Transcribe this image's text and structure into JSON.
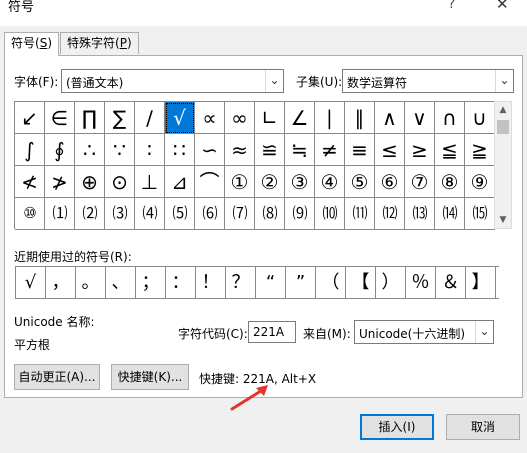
{
  "window": {
    "title": "符号",
    "help_glyph": "?",
    "close_glyph": "✕"
  },
  "tabs": [
    {
      "label": "符号(",
      "key": "S",
      "end": ")"
    },
    {
      "label": "特殊字符(",
      "key": "P",
      "end": ")"
    }
  ],
  "font": {
    "label": "字体(F):",
    "value": "(普通文本)"
  },
  "subset": {
    "label": "子集(U):",
    "value": "数学运算符"
  },
  "symbols": [
    "↙",
    "∈",
    "∏",
    "∑",
    "∕",
    "√",
    "∝",
    "∞",
    "∟",
    "∠",
    "∣",
    "∥",
    "∧",
    "∨",
    "∩",
    "∪",
    "∫",
    "∮",
    "∴",
    "∵",
    "∶",
    "∷",
    "∽",
    "≈",
    "≌",
    "≒",
    "≠",
    "≡",
    "≤",
    "≥",
    "≦",
    "≧",
    "≮",
    "≯",
    "⊕",
    "⊙",
    "⊥",
    "⊿",
    "⌒",
    "①",
    "②",
    "③",
    "④",
    "⑤",
    "⑥",
    "⑦",
    "⑧",
    "⑨",
    "⑩",
    "⑴",
    "⑵",
    "⑶",
    "⑷",
    "⑸",
    "⑹",
    "⑺",
    "⑻",
    "⑼",
    "⑽",
    "⑾",
    "⑿",
    "⒀",
    "⒁",
    "⒂"
  ],
  "selected_index": 5,
  "recent": {
    "label": "近期使用过的符号(R):",
    "items": [
      "√",
      "，",
      "。",
      "、",
      "；",
      "：",
      "！",
      "？",
      "“",
      "”",
      "（",
      "【",
      "）",
      "％",
      "＆",
      "】"
    ]
  },
  "unicode_name": {
    "label": "Unicode 名称:",
    "value": "平方根"
  },
  "char_code": {
    "label": "字符代码(C):",
    "value": "221A"
  },
  "from": {
    "label": "来自(M):",
    "value": "Unicode(十六进制)"
  },
  "buttons": {
    "autocorrect": "自动更正(A)...",
    "shortcut_key": "快捷键(K)...",
    "insert": "插入(I)",
    "cancel": "取消"
  },
  "shortcut_text": "快捷键: 221A, Alt+X",
  "colors": {
    "selection": "#0078d7",
    "arrow": "#e8332b"
  },
  "scroll_glyphs": {
    "up": "▲",
    "down": "▼",
    "dropdown": "⌄"
  }
}
